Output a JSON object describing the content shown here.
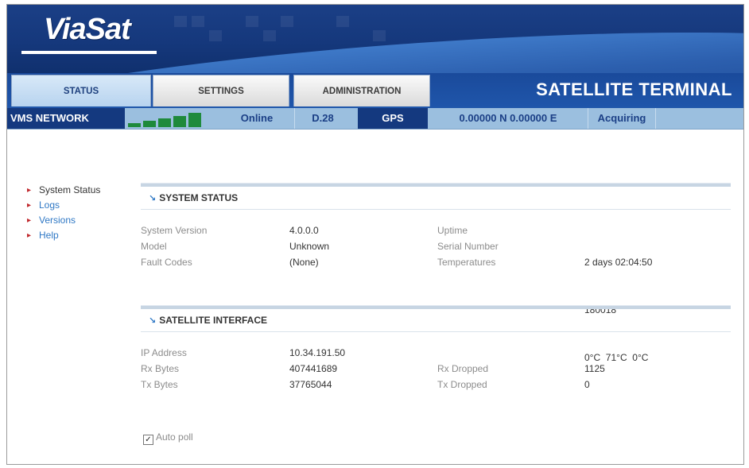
{
  "header": {
    "logo": "ViaSat",
    "terminal_title": "SATELLITE TERMINAL"
  },
  "tabs": [
    {
      "label": "STATUS",
      "active": true
    },
    {
      "label": "SETTINGS",
      "active": false
    },
    {
      "label": "ADMINISTRATION",
      "active": false
    }
  ],
  "statusbar": {
    "network": "VMS NETWORK",
    "signal_level": 5,
    "state": "Online",
    "version": "D.28",
    "gps_label": "GPS",
    "coordinates": "0.00000 N 0.00000 E",
    "gps_state": "Acquiring"
  },
  "nav": [
    {
      "label": "System Status",
      "current": true
    },
    {
      "label": "Logs",
      "current": false
    },
    {
      "label": "Versions",
      "current": false
    },
    {
      "label": "Help",
      "current": false
    }
  ],
  "system_status": {
    "title": "SYSTEM STATUS",
    "system_version_label": "System Version",
    "system_version": "4.0.0.0",
    "model_label": "Model",
    "model": "Unknown",
    "fault_codes_label": "Fault Codes",
    "fault_codes": "(None)",
    "uptime_label": "Uptime",
    "uptime": "2 days 02:04:50",
    "serial_label": "Serial Number",
    "serial": "180018",
    "temperatures_label": "Temperatures",
    "temperatures": "0°C  71°C  0°C"
  },
  "satellite_interface": {
    "title": "SATELLITE INTERFACE",
    "ip_label": "IP Address",
    "ip": "10.34.191.50",
    "rx_bytes_label": "Rx Bytes",
    "rx_bytes": "407441689",
    "tx_bytes_label": "Tx Bytes",
    "tx_bytes": "37765044",
    "rx_dropped_label": "Rx Dropped",
    "rx_dropped": "1125",
    "tx_dropped_label": "Tx Dropped",
    "tx_dropped": "0"
  },
  "autopoll": {
    "label": "Auto poll",
    "checked": true,
    "check_glyph": "✓"
  }
}
